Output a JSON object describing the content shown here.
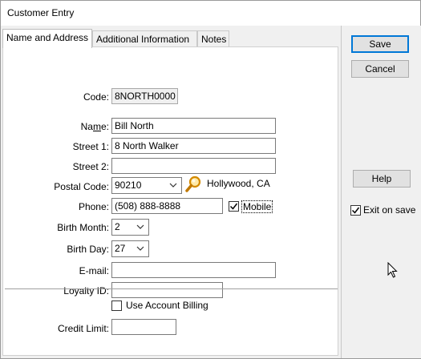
{
  "window": {
    "title": "Customer Entry"
  },
  "tabs": [
    {
      "label": "Name and Address",
      "active": true
    },
    {
      "label": "Additional Information",
      "active": false
    },
    {
      "label": "Notes",
      "active": false
    }
  ],
  "form": {
    "code": {
      "label": "Code:",
      "value": "8NORTH0000"
    },
    "name": {
      "label": "Name:",
      "value": "Bill North"
    },
    "street1": {
      "label": "Street 1:",
      "value": "8 North Walker"
    },
    "street2": {
      "label": "Street 2:",
      "value": ""
    },
    "postal_code": {
      "label": "Postal Code:",
      "value": "90210",
      "city": "Hollywood, CA"
    },
    "phone": {
      "label": "Phone:",
      "value": "(508) 888-8888",
      "mobile_label": "Mobile",
      "mobile_checked": true
    },
    "birth_month": {
      "label": "Birth Month:",
      "value": "2"
    },
    "birth_day": {
      "label": "Birth Day:",
      "value": "27"
    },
    "email": {
      "label": "E-mail:",
      "value": ""
    },
    "loyalty_id": {
      "label": "Loyalty ID:",
      "value": ""
    },
    "use_account_billing": {
      "label": "Use Account Billing",
      "checked": false
    },
    "credit_limit": {
      "label": "Credit Limit:",
      "value": ""
    }
  },
  "buttons": {
    "save": "Save",
    "cancel": "Cancel",
    "help": "Help"
  },
  "exit_on_save": {
    "label": "Exit on save",
    "checked": true
  },
  "colors": {
    "accent": "#0078d7",
    "search_icon": "#d48a00"
  },
  "icons": {
    "postal_lookup": "magnifier-icon"
  }
}
